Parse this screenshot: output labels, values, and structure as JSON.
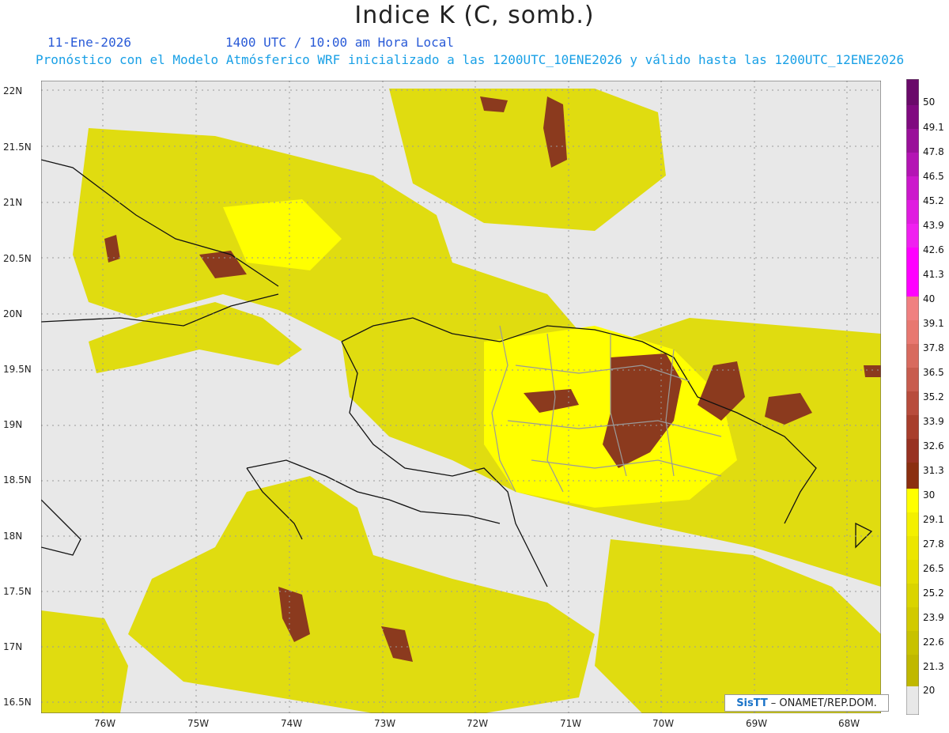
{
  "header": {
    "title": "Indice K (C, somb.)",
    "date": "11-Ene-2026",
    "time": "1400 UTC / 10:00 am Hora Local",
    "forecast_line": "Pronóstico con el Modelo Atmósferico WRF inicializado a las 1200UTC_10ENE2026 y válido hasta las  1200UTC_12ENE2026"
  },
  "axes": {
    "lat_labels": [
      "22N",
      "21.5N",
      "21N",
      "20.5N",
      "20N",
      "19.5N",
      "19N",
      "18.5N",
      "18N",
      "17.5N",
      "17N",
      "16.5N"
    ],
    "lon_labels": [
      "76W",
      "75W",
      "74W",
      "73W",
      "72W",
      "71W",
      "70W",
      "69W",
      "68W"
    ]
  },
  "colorbar": {
    "labels": [
      "50",
      "49.1",
      "47.8",
      "46.5",
      "45.2",
      "43.9",
      "42.6",
      "41.3",
      "40",
      "39.1",
      "37.8",
      "36.5",
      "35.2",
      "33.9",
      "32.6",
      "31.3",
      "30",
      "29.1",
      "27.8",
      "26.5",
      "25.2",
      "23.9",
      "22.6",
      "21.3",
      "20"
    ],
    "colors": {
      "below": "#e8e8e8",
      "yellow_low": "#c8c000",
      "yellow_high": "#ffff00",
      "brown": "#8b3a1e",
      "salmon": "#f08080",
      "magenta": "#ff00ff",
      "purple": "#6a0a6a"
    }
  },
  "credit": {
    "logo": "SisTT",
    "text": "– ONAMET/REP.DOM."
  }
}
